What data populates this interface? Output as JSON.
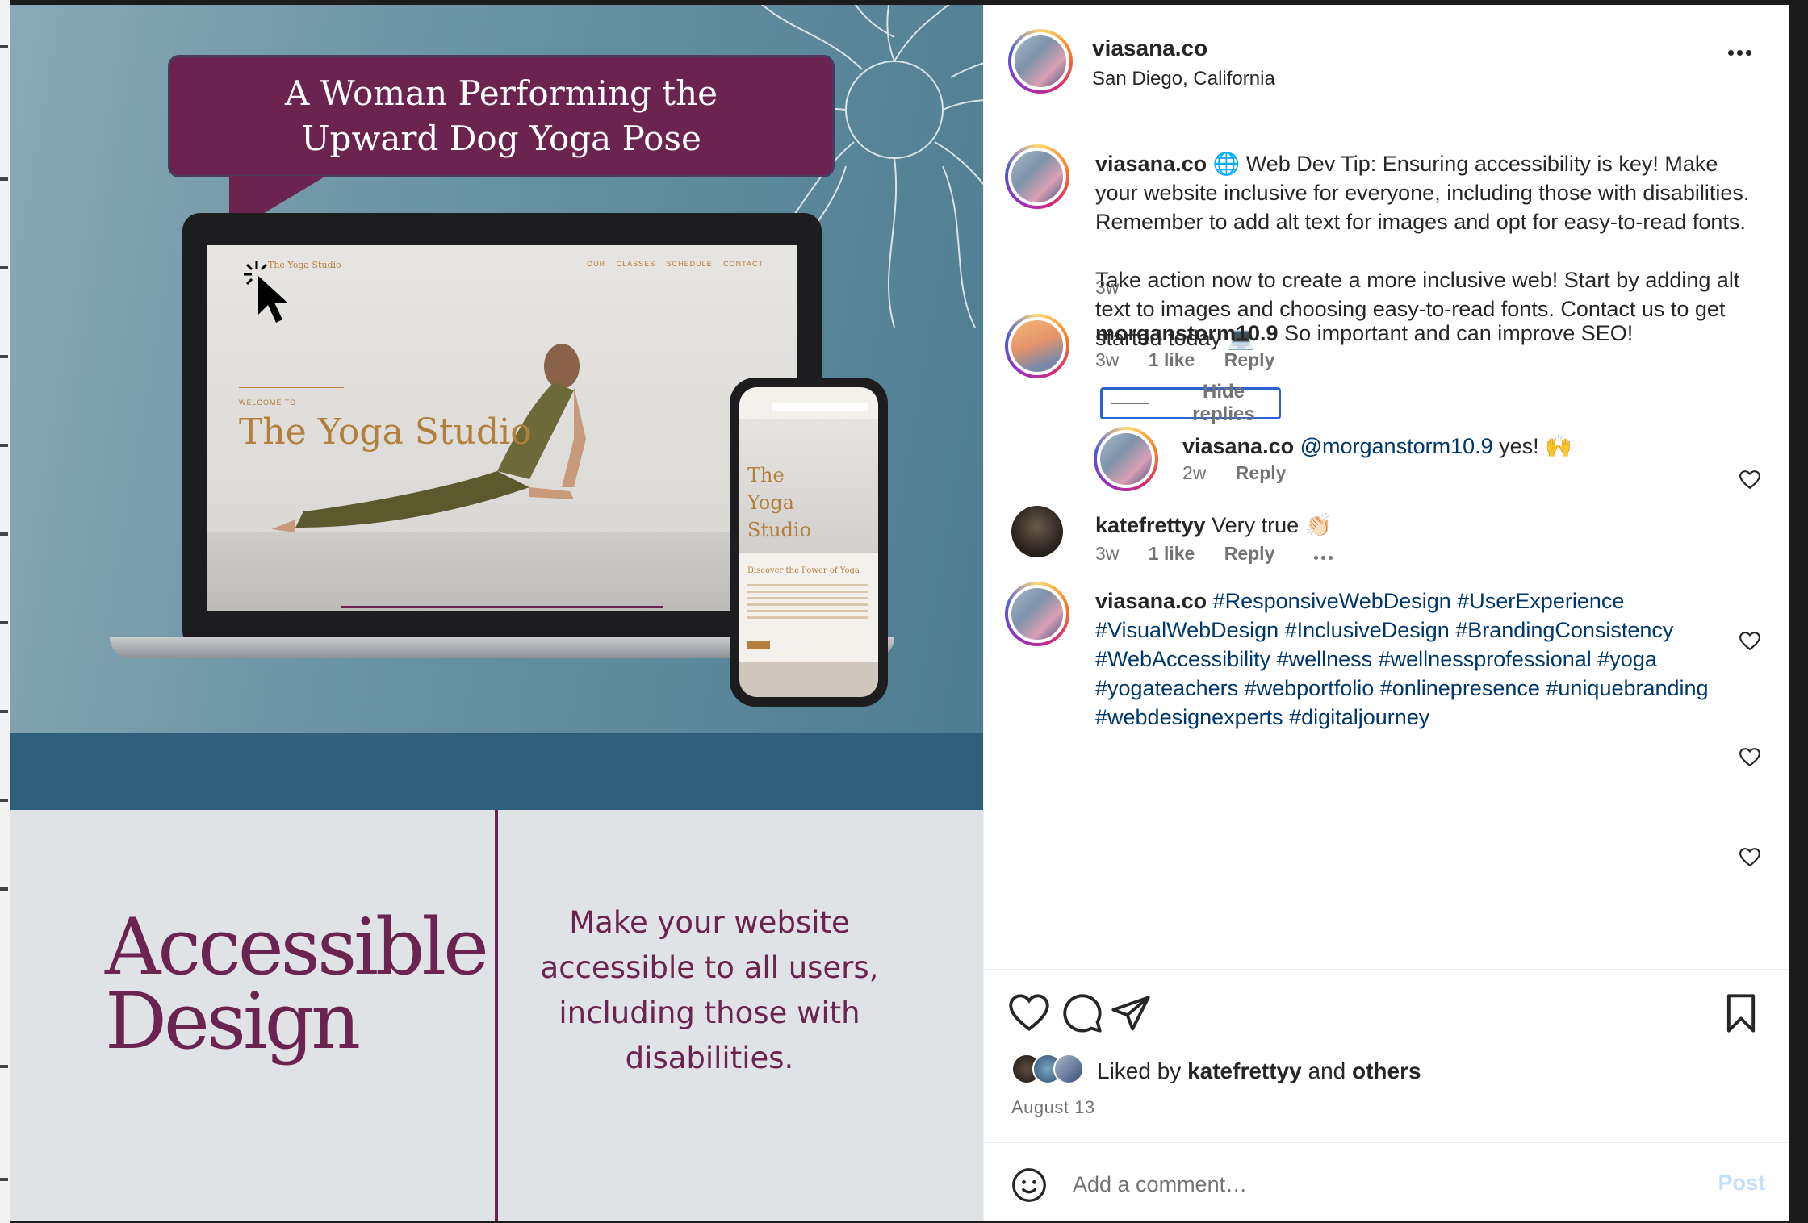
{
  "media": {
    "banner_title": "A Woman Performing the Upward Dog Yoga Pose",
    "laptop_brand": "The Yoga Studio",
    "laptop_nav": "OUR CLASSES  SCHEDULE  CONTACT",
    "laptop_welcome": "WELCOME TO",
    "laptop_site_title": "The Yoga Studio",
    "phone_title": "The Yoga Studio",
    "phone_section": "Discover the Power of Yoga",
    "accessible_title_line1": "Accessible",
    "accessible_title_line2": "Design",
    "accessible_body": "Make your website accessible to all users, including those with disabilities."
  },
  "header": {
    "username": "viasana.co",
    "location": "San Diego, California"
  },
  "caption": {
    "username": "viasana.co",
    "text": " 🌐 Web Dev Tip: Ensuring accessibility is key! Make your website inclusive for everyone, including those with disabilities. Remember to add alt text for images and opt for easy-to-read fonts.\n\nTake action now to create a more inclusive web! Start by adding alt text to images and choosing easy-to-read fonts. Contact us to get started today 💻",
    "time": "3w"
  },
  "comments": [
    {
      "username": "morganstorm10.9",
      "text": " So important and can improve SEO!",
      "time": "3w",
      "likes": "1 like",
      "reply": "Reply",
      "hide_replies": "Hide replies",
      "replies": [
        {
          "username": "viasana.co",
          "mention": "@morganstorm10.9",
          "text": " yes! 🙌",
          "time": "2w",
          "reply": "Reply"
        }
      ]
    },
    {
      "username": "katefrettyy",
      "text": " Very true 👏🏻",
      "time": "3w",
      "likes": "1 like",
      "reply": "Reply"
    },
    {
      "username": "viasana.co",
      "hashtags": "#ResponsiveWebDesign #UserExperience #VisualWebDesign #InclusiveDesign #BrandingConsistency #WebAccessibility #wellness #wellnessprofessional #yoga #yogateachers #webportfolio #onlinepresence #uniquebranding #webdesignexperts #digitaljourney"
    }
  ],
  "likes": {
    "prefix": "Liked by ",
    "user": "katefrettyy",
    "middle": " and ",
    "others": "others"
  },
  "date": "August 13",
  "add_comment": {
    "placeholder": "Add a comment…",
    "post_label": "Post"
  },
  "colors": {
    "brand_plum": "#6b2350",
    "link_blue": "#00376b",
    "muted": "#737373",
    "post_disabled": "#c0dffd"
  }
}
